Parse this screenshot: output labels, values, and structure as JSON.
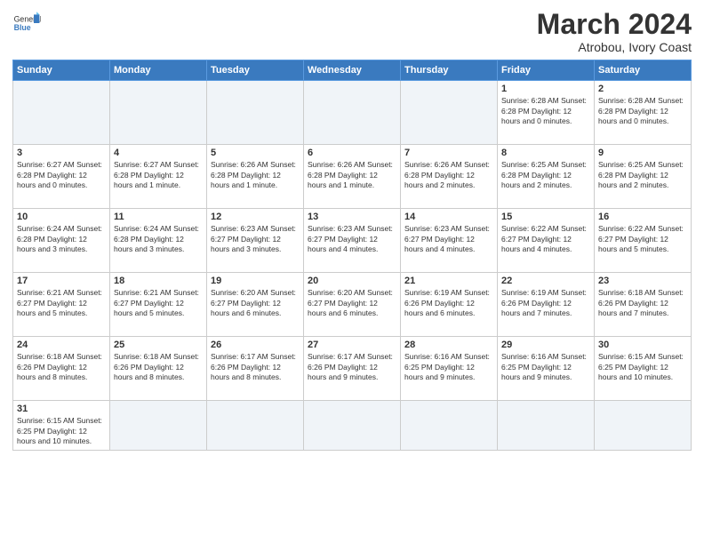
{
  "logo": {
    "text_general": "General",
    "text_blue": "Blue"
  },
  "calendar": {
    "title": "March 2024",
    "subtitle": "Atrobou, Ivory Coast"
  },
  "days_of_week": [
    "Sunday",
    "Monday",
    "Tuesday",
    "Wednesday",
    "Thursday",
    "Friday",
    "Saturday"
  ],
  "weeks": [
    [
      {
        "day": "",
        "info": "",
        "empty": true
      },
      {
        "day": "",
        "info": "",
        "empty": true
      },
      {
        "day": "",
        "info": "",
        "empty": true
      },
      {
        "day": "",
        "info": "",
        "empty": true
      },
      {
        "day": "",
        "info": "",
        "empty": true
      },
      {
        "day": "1",
        "info": "Sunrise: 6:28 AM\nSunset: 6:28 PM\nDaylight: 12 hours\nand 0 minutes."
      },
      {
        "day": "2",
        "info": "Sunrise: 6:28 AM\nSunset: 6:28 PM\nDaylight: 12 hours\nand 0 minutes."
      }
    ],
    [
      {
        "day": "3",
        "info": "Sunrise: 6:27 AM\nSunset: 6:28 PM\nDaylight: 12 hours\nand 0 minutes."
      },
      {
        "day": "4",
        "info": "Sunrise: 6:27 AM\nSunset: 6:28 PM\nDaylight: 12 hours\nand 1 minute."
      },
      {
        "day": "5",
        "info": "Sunrise: 6:26 AM\nSunset: 6:28 PM\nDaylight: 12 hours\nand 1 minute."
      },
      {
        "day": "6",
        "info": "Sunrise: 6:26 AM\nSunset: 6:28 PM\nDaylight: 12 hours\nand 1 minute."
      },
      {
        "day": "7",
        "info": "Sunrise: 6:26 AM\nSunset: 6:28 PM\nDaylight: 12 hours\nand 2 minutes."
      },
      {
        "day": "8",
        "info": "Sunrise: 6:25 AM\nSunset: 6:28 PM\nDaylight: 12 hours\nand 2 minutes."
      },
      {
        "day": "9",
        "info": "Sunrise: 6:25 AM\nSunset: 6:28 PM\nDaylight: 12 hours\nand 2 minutes."
      }
    ],
    [
      {
        "day": "10",
        "info": "Sunrise: 6:24 AM\nSunset: 6:28 PM\nDaylight: 12 hours\nand 3 minutes."
      },
      {
        "day": "11",
        "info": "Sunrise: 6:24 AM\nSunset: 6:28 PM\nDaylight: 12 hours\nand 3 minutes."
      },
      {
        "day": "12",
        "info": "Sunrise: 6:23 AM\nSunset: 6:27 PM\nDaylight: 12 hours\nand 3 minutes."
      },
      {
        "day": "13",
        "info": "Sunrise: 6:23 AM\nSunset: 6:27 PM\nDaylight: 12 hours\nand 4 minutes."
      },
      {
        "day": "14",
        "info": "Sunrise: 6:23 AM\nSunset: 6:27 PM\nDaylight: 12 hours\nand 4 minutes."
      },
      {
        "day": "15",
        "info": "Sunrise: 6:22 AM\nSunset: 6:27 PM\nDaylight: 12 hours\nand 4 minutes."
      },
      {
        "day": "16",
        "info": "Sunrise: 6:22 AM\nSunset: 6:27 PM\nDaylight: 12 hours\nand 5 minutes."
      }
    ],
    [
      {
        "day": "17",
        "info": "Sunrise: 6:21 AM\nSunset: 6:27 PM\nDaylight: 12 hours\nand 5 minutes."
      },
      {
        "day": "18",
        "info": "Sunrise: 6:21 AM\nSunset: 6:27 PM\nDaylight: 12 hours\nand 5 minutes."
      },
      {
        "day": "19",
        "info": "Sunrise: 6:20 AM\nSunset: 6:27 PM\nDaylight: 12 hours\nand 6 minutes."
      },
      {
        "day": "20",
        "info": "Sunrise: 6:20 AM\nSunset: 6:27 PM\nDaylight: 12 hours\nand 6 minutes."
      },
      {
        "day": "21",
        "info": "Sunrise: 6:19 AM\nSunset: 6:26 PM\nDaylight: 12 hours\nand 6 minutes."
      },
      {
        "day": "22",
        "info": "Sunrise: 6:19 AM\nSunset: 6:26 PM\nDaylight: 12 hours\nand 7 minutes."
      },
      {
        "day": "23",
        "info": "Sunrise: 6:18 AM\nSunset: 6:26 PM\nDaylight: 12 hours\nand 7 minutes."
      }
    ],
    [
      {
        "day": "24",
        "info": "Sunrise: 6:18 AM\nSunset: 6:26 PM\nDaylight: 12 hours\nand 8 minutes."
      },
      {
        "day": "25",
        "info": "Sunrise: 6:18 AM\nSunset: 6:26 PM\nDaylight: 12 hours\nand 8 minutes."
      },
      {
        "day": "26",
        "info": "Sunrise: 6:17 AM\nSunset: 6:26 PM\nDaylight: 12 hours\nand 8 minutes."
      },
      {
        "day": "27",
        "info": "Sunrise: 6:17 AM\nSunset: 6:26 PM\nDaylight: 12 hours\nand 9 minutes."
      },
      {
        "day": "28",
        "info": "Sunrise: 6:16 AM\nSunset: 6:25 PM\nDaylight: 12 hours\nand 9 minutes."
      },
      {
        "day": "29",
        "info": "Sunrise: 6:16 AM\nSunset: 6:25 PM\nDaylight: 12 hours\nand 9 minutes."
      },
      {
        "day": "30",
        "info": "Sunrise: 6:15 AM\nSunset: 6:25 PM\nDaylight: 12 hours\nand 10 minutes."
      }
    ],
    [
      {
        "day": "31",
        "info": "Sunrise: 6:15 AM\nSunset: 6:25 PM\nDaylight: 12 hours\nand 10 minutes."
      },
      {
        "day": "",
        "info": "",
        "empty": true
      },
      {
        "day": "",
        "info": "",
        "empty": true
      },
      {
        "day": "",
        "info": "",
        "empty": true
      },
      {
        "day": "",
        "info": "",
        "empty": true
      },
      {
        "day": "",
        "info": "",
        "empty": true
      },
      {
        "day": "",
        "info": "",
        "empty": true
      }
    ]
  ]
}
